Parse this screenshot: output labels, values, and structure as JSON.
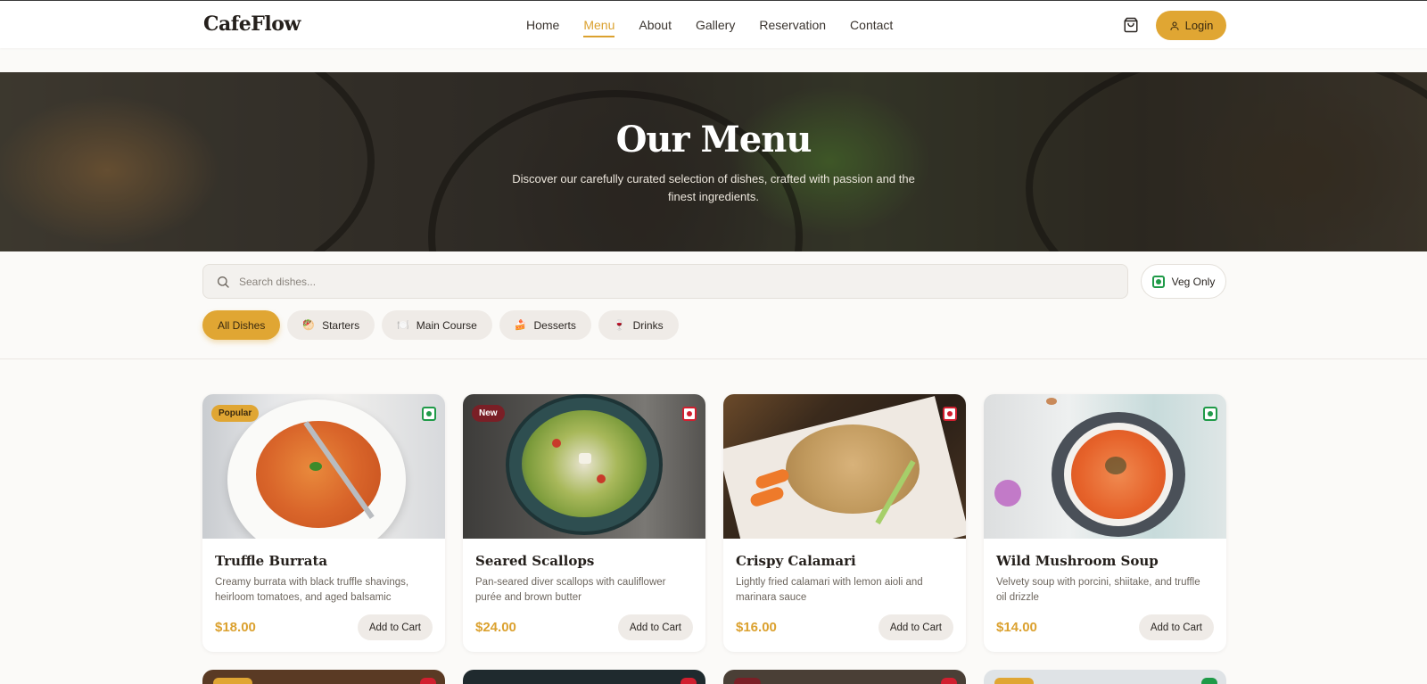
{
  "header": {
    "logo": "CafeFlow",
    "nav": [
      "Home",
      "Menu",
      "About",
      "Gallery",
      "Reservation",
      "Contact"
    ],
    "active_nav": "Menu",
    "cart_icon": "shopping-bag-icon",
    "login_label": "Login",
    "accent": "#e0a633"
  },
  "hero": {
    "title": "Our Menu",
    "subtitle": "Discover our carefully curated selection of dishes, crafted with passion and the finest ingredients."
  },
  "filters": {
    "search_placeholder": "Search dishes...",
    "search_value": "",
    "veg_only_label": "Veg Only",
    "categories": [
      {
        "label": "All Dishes",
        "emoji": "",
        "active": true
      },
      {
        "label": "Starters",
        "emoji": "🥙",
        "active": false
      },
      {
        "label": "Main Course",
        "emoji": "🍽️",
        "active": false
      },
      {
        "label": "Desserts",
        "emoji": "🍰",
        "active": false
      },
      {
        "label": "Drinks",
        "emoji": "🍷",
        "active": false
      }
    ]
  },
  "dishes": [
    {
      "name": "Truffle Burrata",
      "description": "Creamy burrata with black truffle shavings, heirloom tomatoes, and aged balsamic",
      "price": "$18.00",
      "badge": "Popular",
      "veg": true,
      "button": "Add to Cart"
    },
    {
      "name": "Seared Scallops",
      "description": "Pan-seared diver scallops with cauliflower purée and brown butter",
      "price": "$24.00",
      "badge": "New",
      "veg": false,
      "button": "Add to Cart"
    },
    {
      "name": "Crispy Calamari",
      "description": "Lightly fried calamari with lemon aioli and marinara sauce",
      "price": "$16.00",
      "badge": "",
      "veg": false,
      "button": "Add to Cart"
    },
    {
      "name": "Wild Mushroom Soup",
      "description": "Velvety soup with porcini, shiitake, and truffle oil drizzle",
      "price": "$14.00",
      "badge": "",
      "veg": true,
      "button": "Add to Cart"
    }
  ]
}
